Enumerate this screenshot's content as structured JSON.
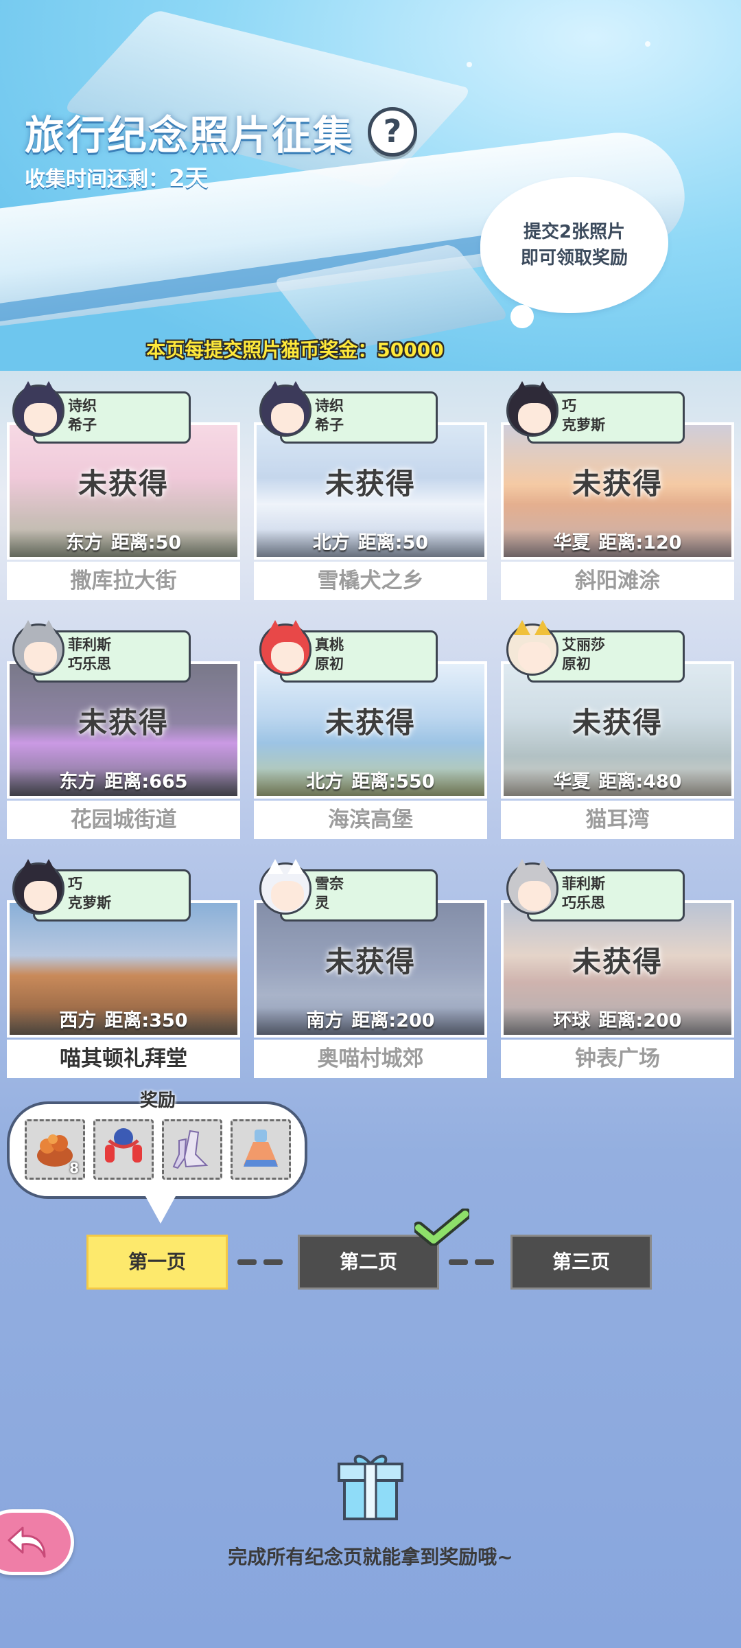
{
  "header": {
    "title": "旅行纪念照片征集",
    "help_icon": "?",
    "timer_label": "收集时间还剩：",
    "timer_value": "2天",
    "cloud_line1": "提交2张照片",
    "cloud_line2": "即可领取奖励",
    "bonus_text": "本页每提交照片猫币奖金：50000"
  },
  "cards": [
    {
      "char1": "诗织",
      "char2": "希子",
      "status": "未获得",
      "dir": "东方",
      "dist": "距离:50",
      "name": "撒库拉大街",
      "obtained": false
    },
    {
      "char1": "诗织",
      "char2": "希子",
      "status": "未获得",
      "dir": "北方",
      "dist": "距离:50",
      "name": "雪橇犬之乡",
      "obtained": false
    },
    {
      "char1": "巧",
      "char2": "克萝斯",
      "status": "未获得",
      "dir": "华夏",
      "dist": "距离:120",
      "name": "斜阳滩涂",
      "obtained": false
    },
    {
      "char1": "菲利斯",
      "char2": "巧乐思",
      "status": "未获得",
      "dir": "东方",
      "dist": "距离:665",
      "name": "花园城街道",
      "obtained": false
    },
    {
      "char1": "真桃",
      "char2": "原初",
      "status": "未获得",
      "dir": "北方",
      "dist": "距离:550",
      "name": "海滨高堡",
      "obtained": false
    },
    {
      "char1": "艾丽莎",
      "char2": "原初",
      "status": "未获得",
      "dir": "华夏",
      "dist": "距离:480",
      "name": "猫耳湾",
      "obtained": false
    },
    {
      "char1": "巧",
      "char2": "克萝斯",
      "status": "",
      "dir": "西方",
      "dist": "距离:350",
      "name": "喵其顿礼拜堂",
      "obtained": true
    },
    {
      "char1": "雪奈",
      "char2": "灵",
      "status": "未获得",
      "dir": "南方",
      "dist": "距离:200",
      "name": "奥喵村城郊",
      "obtained": false
    },
    {
      "char1": "菲利斯",
      "char2": "巧乐思",
      "status": "未获得",
      "dir": "环球",
      "dist": "距离:200",
      "name": "钟表广场",
      "obtained": false
    }
  ],
  "rewards": {
    "title": "奖励",
    "items": [
      {
        "icon": "food-basket-icon",
        "qty": "8"
      },
      {
        "icon": "lantern-decoration-icon",
        "qty": ""
      },
      {
        "icon": "boots-icon",
        "qty": ""
      },
      {
        "icon": "dress-icon",
        "qty": ""
      }
    ]
  },
  "pages": {
    "page1": "第一页",
    "page2": "第二页",
    "page3": "第三页",
    "active": 1,
    "completed": [
      2
    ]
  },
  "footer": {
    "text": "完成所有纪念页就能拿到奖励哦~"
  },
  "colors": {
    "tag_bg": "#e0f7e4",
    "active_page": "#fde96c",
    "inactive_page": "#4d4d4d",
    "bonus_text": "#ffe93a",
    "back_button": "#ef7ea7"
  }
}
